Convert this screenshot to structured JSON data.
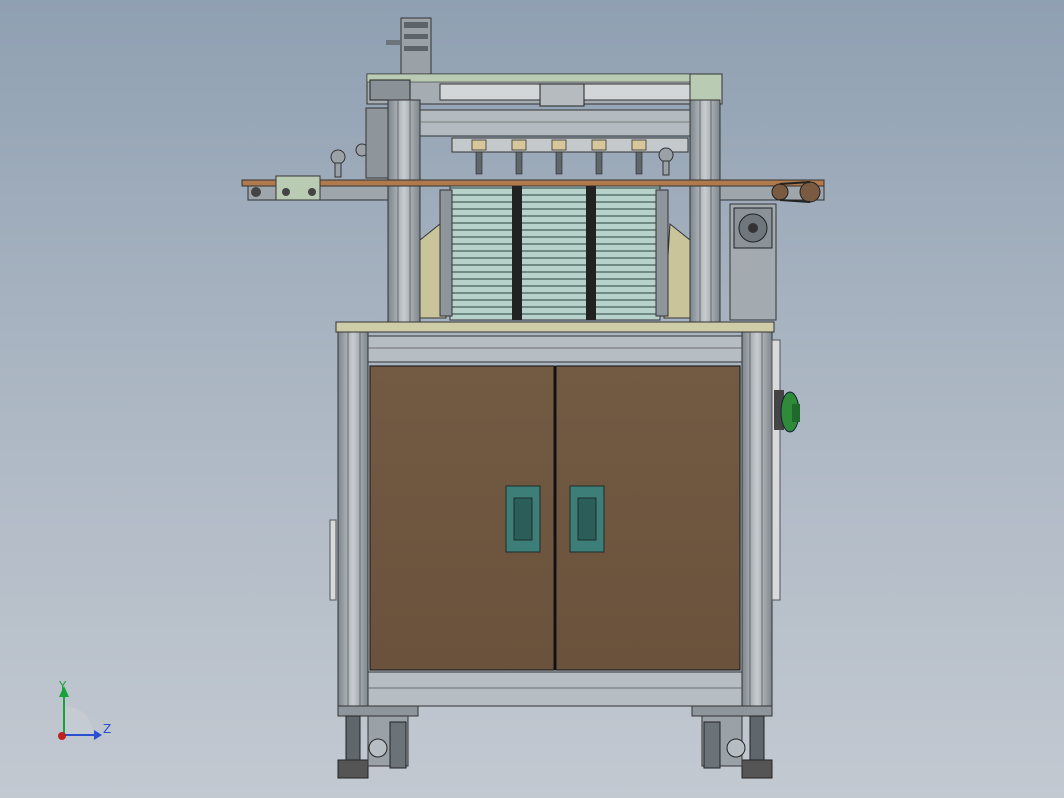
{
  "viewport": {
    "background_top": "#8fa0b2",
    "background_bottom": "#c3c9d1"
  },
  "model": {
    "cabinet_door_color": "#6e5640",
    "frame_color": "#9aa3aa",
    "handle_color": "#3d7f78",
    "tabletop_color": "#cfcca8",
    "estop_color": "#2f8a3a",
    "plate_stack_color": "#a9c8c0"
  },
  "triad": {
    "y_label": "Y",
    "z_label": "Z",
    "y_color": "#19a23a",
    "z_color": "#2a4fd0",
    "x_color": "#c02020"
  }
}
